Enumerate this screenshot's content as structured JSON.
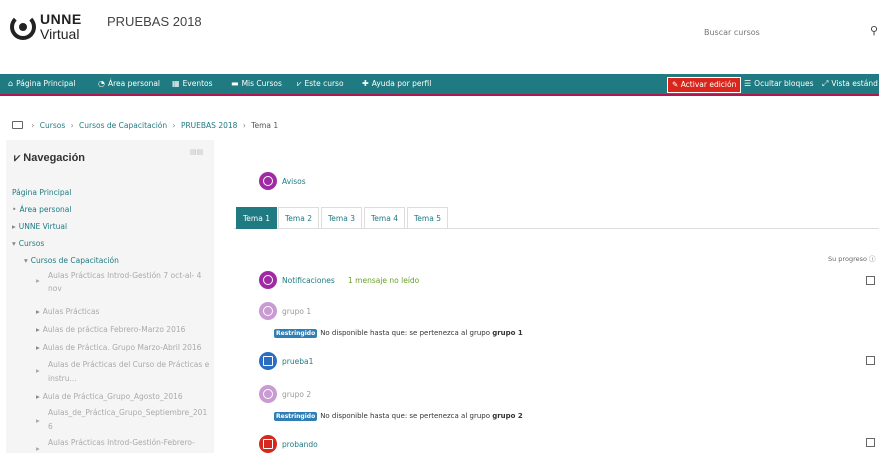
{
  "header": {
    "logo_line1": "UNNE",
    "logo_line2": "Virtual",
    "site_title": "PRUEBAS 2018",
    "search_placeholder": "Buscar cursos"
  },
  "navbar": {
    "items": [
      {
        "icon": "home-icon",
        "label": "Página Principal"
      },
      {
        "icon": "dashboard-icon",
        "label": "Área personal"
      },
      {
        "icon": "calendar-icon",
        "label": "Eventos"
      },
      {
        "icon": "courses-icon",
        "label": "Mis Cursos"
      },
      {
        "icon": "sitemap-icon",
        "label": "Este curso"
      },
      {
        "icon": "help-icon",
        "label": "Ayuda por perfil"
      }
    ],
    "edit_button": "Activar edición",
    "hide_blocks": "Ocultar bloques",
    "standard_view": "Vista estánd",
    "accent": "#1f7a82",
    "edit_color": "#d9261c"
  },
  "breadcrumb": [
    "Cursos",
    "Cursos de Capacitación",
    "PRUEBAS 2018",
    "Tema 1"
  ],
  "sidebar": {
    "title": "Navegación",
    "items": [
      {
        "label": "Página Principal",
        "level": 0
      },
      {
        "label": "Área personal",
        "level": 0,
        "prefix": "•"
      },
      {
        "label": "UNNE Virtual",
        "level": 0,
        "prefix": "▸"
      },
      {
        "label": "Cursos",
        "level": 0,
        "prefix": "▾"
      },
      {
        "label": "Cursos de Capacitación",
        "level": 1,
        "prefix": "▾"
      },
      {
        "label": "Aulas Prácticas Introd-Gestión 7 oct-al- 4",
        "label2": "nov",
        "level": 2
      },
      {
        "label": "Aulas Prácticas",
        "level": 2
      },
      {
        "label": "Aulas de práctica Febrero-Marzo 2016",
        "level": 2
      },
      {
        "label": "Aulas de Práctica. Grupo Marzo-Abril 2016",
        "level": 2
      },
      {
        "label": "Aulas de Prácticas del Curso de Prácticas e",
        "label2": "instru...",
        "level": 2
      },
      {
        "label": "Aula de Práctica_Grupo_Agosto_2016",
        "level": 2
      },
      {
        "label": "Aulas_de_Práctica_Grupo_Septiembre_201",
        "label2": "6",
        "level": 2
      },
      {
        "label": "Aulas Prácticas Introd-Gestión-Febrero-",
        "level": 2
      }
    ]
  },
  "main": {
    "announcements": "Avisos",
    "tabs": [
      "Tema 1",
      "Tema 2",
      "Tema 3",
      "Tema 4",
      "Tema 5"
    ],
    "progress_label": "Su progreso",
    "activities": [
      {
        "icon": "forum-icon",
        "label": "Notificaciones",
        "badge": "1 mensaje no leído"
      },
      {
        "icon": "forum-icon",
        "label": "grupo 1",
        "restricted_tag": "Restringido",
        "restriction": "No disponible hasta que: se pertenezca al grupo",
        "group": "grupo 1"
      },
      {
        "icon": "file-icon",
        "label": "prueba1"
      },
      {
        "icon": "forum-icon",
        "label": "grupo 2",
        "restricted_tag": "Restringido",
        "restriction": "No disponible hasta que: se pertenezca al grupo",
        "group": "grupo 2"
      },
      {
        "icon": "pdf-icon",
        "label": "probando"
      }
    ]
  }
}
